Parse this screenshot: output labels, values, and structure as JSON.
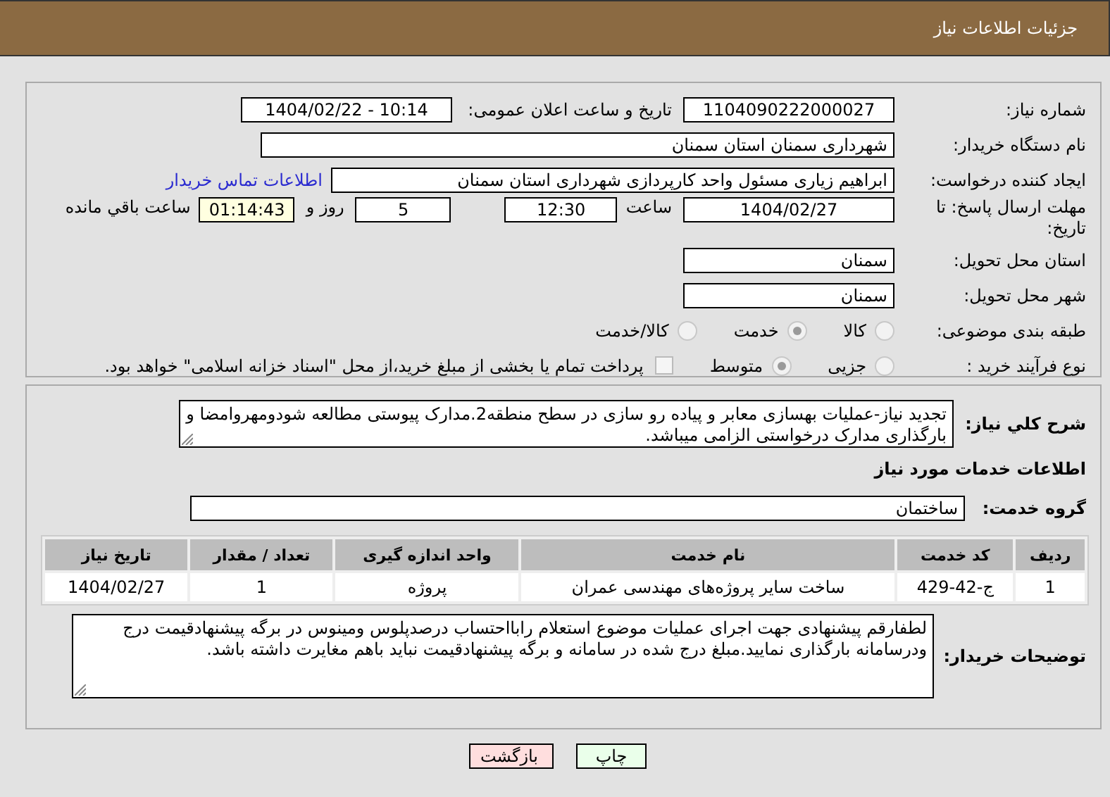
{
  "header": {
    "title": "جزئیات اطلاعات نیاز"
  },
  "details": {
    "need_number": {
      "label": "شماره نیاز:",
      "value": "1104090222000027"
    },
    "announce": {
      "label": "تاریخ و ساعت اعلان عمومی:",
      "value": "1404/02/22 - 10:14"
    },
    "buyer": {
      "label": "نام دستگاه خریدار:",
      "value": "شهرداری سمنان استان سمنان"
    },
    "creator": {
      "label": "ایجاد کننده درخواست:",
      "value": "ابراهیم زیاری مسئول واحد کارپردازی شهرداری استان سمنان",
      "link": "اطلاعات تماس خریدار"
    },
    "deadline": {
      "label": "مهلت ارسال پاسخ: تا تاریخ:",
      "date": "1404/02/27",
      "time_label": "ساعت",
      "time": "12:30",
      "days": "5",
      "days_label": "روز و",
      "remaining": "01:14:43",
      "remaining_label": "ساعت باقي مانده"
    },
    "province": {
      "label": "استان محل تحویل:",
      "value": "سمنان"
    },
    "city": {
      "label": "شهر محل تحویل:",
      "value": "سمنان"
    },
    "category": {
      "label": "طبقه بندی موضوعی:",
      "options": [
        {
          "label": "کالا",
          "selected": false
        },
        {
          "label": "خدمت",
          "selected": true
        },
        {
          "label": "کالا/خدمت",
          "selected": false
        }
      ]
    },
    "process": {
      "label": "نوع فرآیند خرید :",
      "options": [
        {
          "label": "جزیی",
          "selected": false
        },
        {
          "label": "متوسط",
          "selected": true
        }
      ],
      "treasury": {
        "checked": false,
        "text": "پرداخت تمام یا بخشی از مبلغ خرید،از محل \"اسناد خزانه اسلامی\" خواهد بود."
      }
    }
  },
  "services": {
    "description_label": "شرح کلي نیاز:",
    "description": "تجدید نیاز-عملیات بهسازی معابر و پیاده رو سازی در سطح منطقه2.مدارک پیوستی مطالعه شودومهروامضا و بارگذاری مدارک درخواستی الزامی میباشد.",
    "heading": "اطلاعات خدمات مورد نیاز",
    "group_label": "گروه خدمت:",
    "group": "ساختمان",
    "table": {
      "columns": [
        "ردیف",
        "کد خدمت",
        "نام خدمت",
        "واحد اندازه گیری",
        "تعداد / مقدار",
        "تاریخ نیاز"
      ],
      "rows": [
        [
          "1",
          "ج-42-429",
          "ساخت سایر پروژه‌های مهندسی عمران",
          "پروژه",
          "1",
          "1404/02/27"
        ]
      ]
    },
    "notes_label": "توضیحات خریدار:",
    "notes": "لطفارقم پیشنهادی جهت اجرای عملیات موضوع استعلام رابااحتساب درصدپلوس ومینوس در برگه پیشنهادقیمت درج ودرسامانه بارگذاری نمایید.مبلغ درج شده در سامانه و برگه پیشنهادقیمت نباید باهم مغایرت داشته باشد."
  },
  "buttons": [
    {
      "label": "چاپ",
      "kind": "print"
    },
    {
      "label": "بازگشت",
      "kind": "back"
    }
  ]
}
